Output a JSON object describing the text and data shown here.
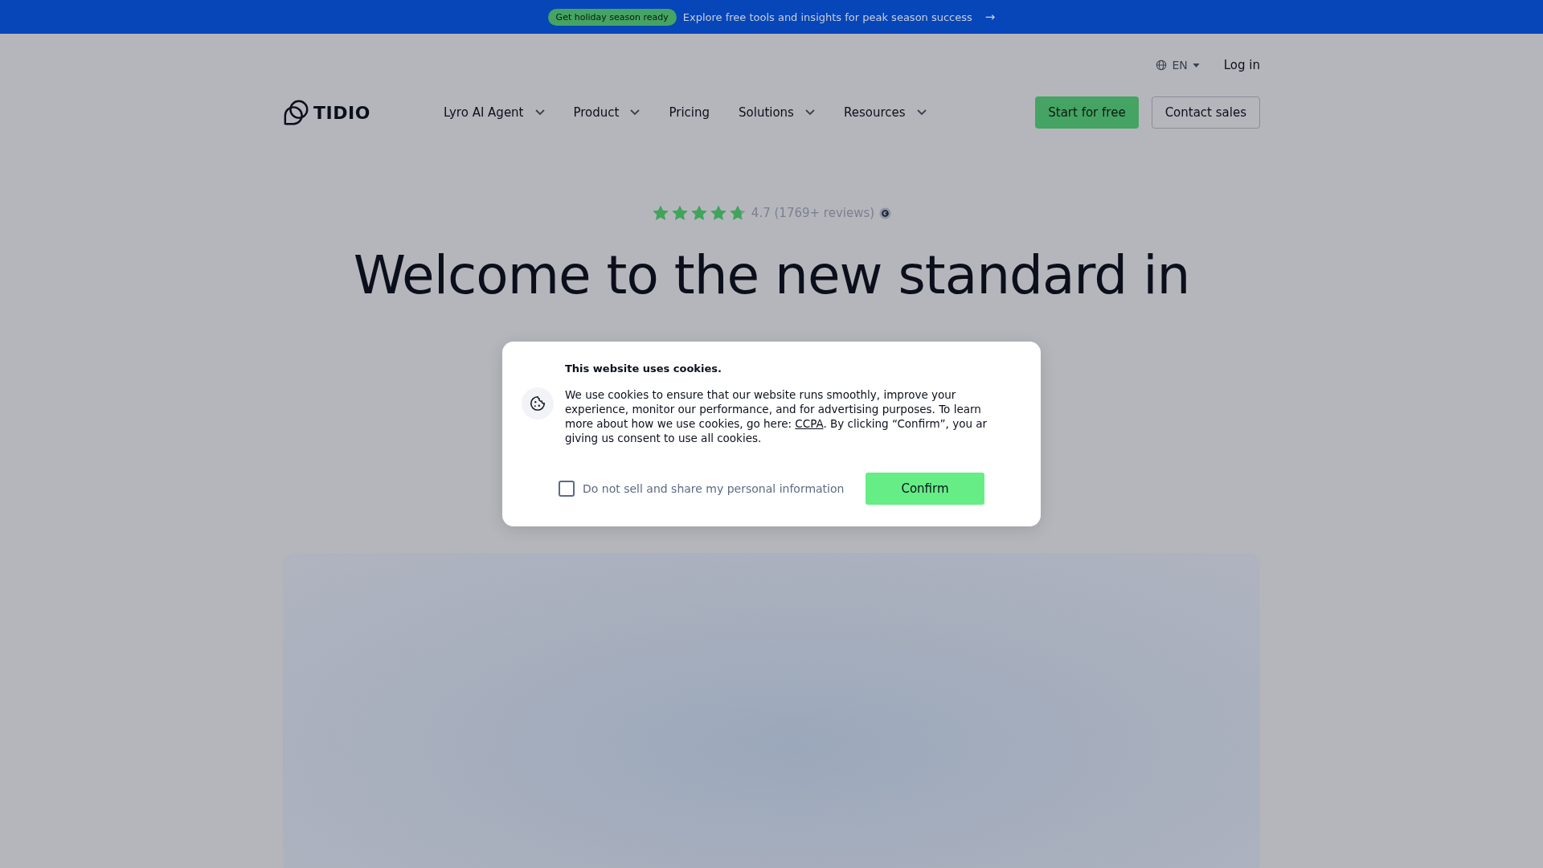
{
  "banner": {
    "badge": "Get holiday season ready",
    "text": "Explore free tools and insights for peak season success",
    "arrow": "→"
  },
  "top_links": {
    "language": "EN",
    "login": "Log in"
  },
  "logo": {
    "text": "TIDIO"
  },
  "nav": [
    {
      "label": "Lyro AI Agent",
      "dropdown": true
    },
    {
      "label": "Product",
      "dropdown": true
    },
    {
      "label": "Pricing",
      "dropdown": false
    },
    {
      "label": "Solutions",
      "dropdown": true
    },
    {
      "label": "Resources",
      "dropdown": true
    }
  ],
  "actions": {
    "primary": "Start for free",
    "secondary": "Contact sales"
  },
  "rating": {
    "stars": 4.7,
    "text": "4.7 (1769+ reviews)"
  },
  "heading": "Welcome to the new standard in",
  "cookie_dialog": {
    "title": "This website uses cookies.",
    "text_before": "We use cookies to ensure that our website runs smoothly, improve your experience, monitor our performance, and for advertising purposes. To learn more about how we use cookies, go here: ",
    "link": "CCPA",
    "text_after": ". By clicking “Confirm”, you ar giving us consent to use all cookies.",
    "checkbox": {
      "label": "Do not sell and share my personal information",
      "checked": false
    },
    "confirm": "Confirm"
  }
}
